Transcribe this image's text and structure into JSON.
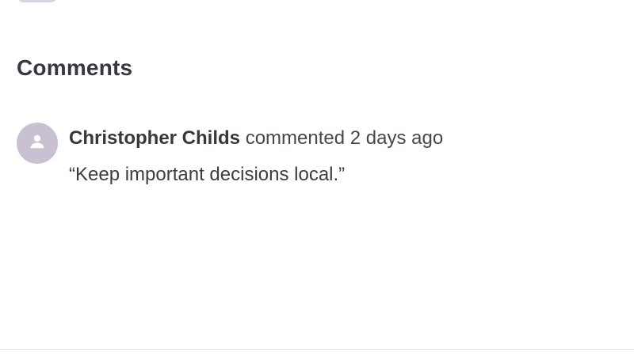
{
  "comments_section": {
    "title": "Comments",
    "items": [
      {
        "author": "Christopher Childs",
        "action": "commented 2 days ago",
        "body": "“Keep important decisions local.”",
        "avatar_icon": "user-icon",
        "avatar_color": "#c9c1d1"
      }
    ]
  },
  "colors": {
    "text_primary": "#3b3540",
    "avatar_bg": "#c9c1d1",
    "divider": "#e6e3e9"
  }
}
